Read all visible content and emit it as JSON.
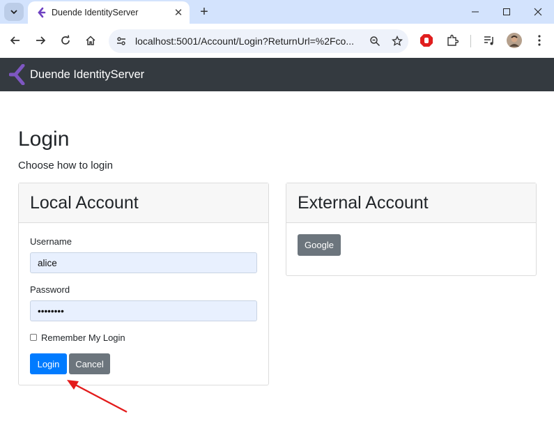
{
  "browser": {
    "tab_title": "Duende IdentityServer",
    "url": "localhost:5001/Account/Login?ReturnUrl=%2Fco..."
  },
  "navbar": {
    "brand": "Duende IdentityServer"
  },
  "page": {
    "title": "Login",
    "subtitle": "Choose how to login"
  },
  "local_account": {
    "header": "Local Account",
    "username_label": "Username",
    "username_value": "alice",
    "password_label": "Password",
    "password_value": "••••••••",
    "remember_label": "Remember My Login",
    "remember_checked": false,
    "login_button": "Login",
    "cancel_button": "Cancel"
  },
  "external_account": {
    "header": "External Account",
    "providers": [
      "Google"
    ]
  },
  "colors": {
    "navbar": "#343a40",
    "primary": "#007bff",
    "secondary": "#6c757d",
    "brand_purple": "#6f42c1",
    "annotation_arrow": "#e31b1b"
  },
  "icons": {
    "tab_favicon": "duende-logo-icon",
    "brand_logo": "duende-logo-icon",
    "back": "arrow-left-icon",
    "forward": "arrow-right-icon",
    "reload": "reload-icon",
    "home": "home-icon",
    "site_settings": "tune-icon",
    "zoom": "zoom-icon",
    "bookmark": "star-icon",
    "extension_adblock": "stop-hand-icon",
    "extensions": "puzzle-icon",
    "media": "media-queue-icon",
    "profile": "avatar",
    "menu": "kebab-menu-icon"
  }
}
